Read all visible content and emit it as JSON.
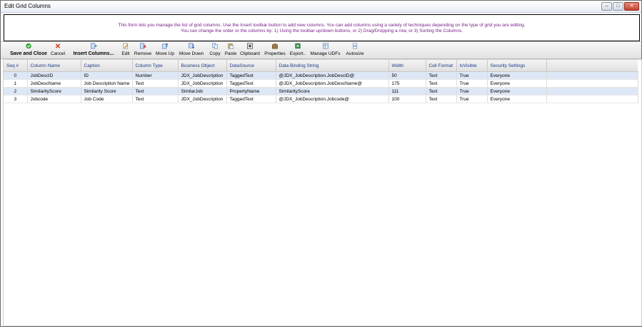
{
  "window": {
    "title": "Edit Grid Columns"
  },
  "info": {
    "line1": "This form lets you manage the list of grid columns.  Use the Insert toolbar button to add new columns. You can add columns using a variety of techniques depending on the type of grid you are editing.",
    "line2": "You can change the order or the columns by: 1) Using the toolbar up/down buttons, or 2) Drag/Dropping a row, or 3) Sorting the Columns."
  },
  "toolbar": {
    "save": "Save and Close",
    "cancel": "Cancel",
    "insert": "Insert Columns...",
    "edit": "Edit",
    "remove": "Remove",
    "move_up": "Move Up",
    "move_down": "Move Down",
    "copy": "Copy",
    "paste": "Paste",
    "clipboard": "Clipboard",
    "properties": "Properties",
    "export": "Export..",
    "manage_udfs": "Manage UDFs",
    "autosize": "Autosize"
  },
  "grid": {
    "headers": [
      "Seq #",
      "Column Name",
      "Caption",
      "Column Type",
      "Business Object",
      "DataSource",
      "Data Binding String",
      "Width",
      "Cell Format",
      "IsVisible",
      "Security Settings"
    ],
    "rows": [
      [
        "0",
        "JobDescID",
        "ID",
        "Number",
        "JDX_JobDescription",
        "TaggedText",
        "@JDX_JobDescription.JobDescID@",
        "50",
        "Text",
        "True",
        "Everyone"
      ],
      [
        "1",
        "JobDescName",
        "Job Description Name",
        "Text",
        "JDX_JobDescription",
        "TaggedText",
        "@JDX_JobDescription.JobDescName@",
        "175",
        "Text",
        "True",
        "Everyone"
      ],
      [
        "2",
        "SimilarityScore",
        "Similarity Score",
        "Text",
        "SimilarJob",
        "PropertyName",
        "SimilarityScore",
        "111",
        "Text",
        "True",
        "Everyone"
      ],
      [
        "3",
        "Jobcode",
        "Job Code",
        "Text",
        "JDX_JobDescription",
        "TaggedText",
        "@JDX_JobDescription.Jobcode@",
        "100",
        "Text",
        "True",
        "Everyone"
      ]
    ]
  },
  "colors": {
    "accent_text": "#7a1f8a",
    "header_text": "#1f3a8a",
    "row_highlight": "#dde7f5"
  }
}
